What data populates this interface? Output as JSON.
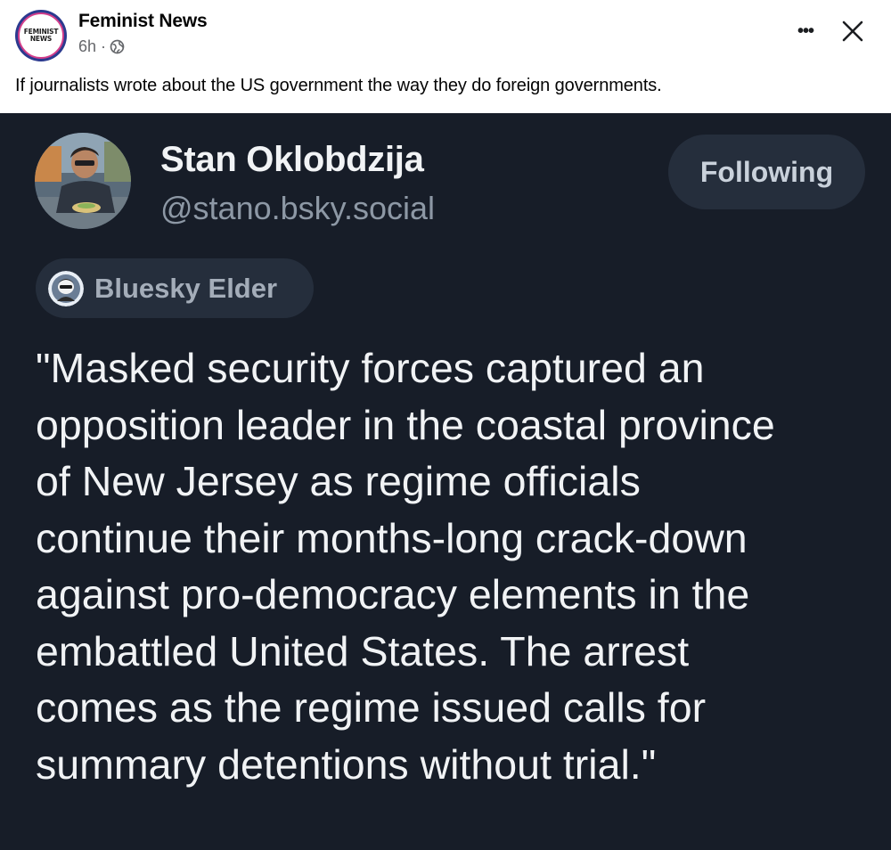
{
  "post": {
    "page_avatar_text": [
      "FEMINIST",
      "NEWS"
    ],
    "page_name": "Feminist News",
    "timestamp": "6h ·",
    "audience_icon": "globe-icon",
    "caption": "If journalists wrote about the US government the way they do foreign governments."
  },
  "embedded": {
    "author_name": "Stan Oklobdzija",
    "author_handle": "@stano.bsky.social",
    "follow_label": "Following",
    "badge_label": "Bluesky Elder",
    "text": "\"Masked security forces captured an\nopposition leader in the coastal province\nof New Jersey as regime officials\ncontinue their months-long crack-down\nagainst pro-democracy elements in the\nembattled United States. The arrest\ncomes as the regime issued calls for\nsummary detentions without trial.\""
  },
  "colors": {
    "card_background": "#171d28",
    "pill_background": "#252e3c",
    "text_primary": "#f1f3f5",
    "text_secondary": "#8d98a5",
    "fb_meta": "#65676b"
  }
}
